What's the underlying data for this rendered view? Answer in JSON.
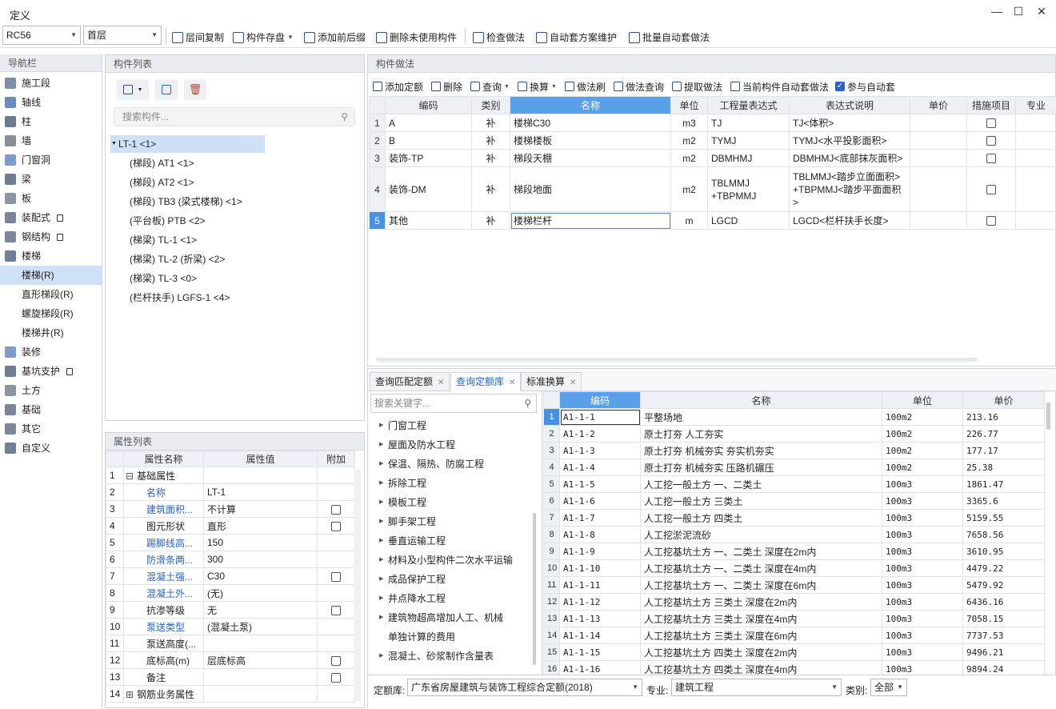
{
  "window": {
    "title": "定义",
    "min": "—",
    "max": "☐",
    "close": "✕"
  },
  "toolbar": {
    "spec_select": "RC56",
    "floor_select": "首层",
    "buttons": [
      "层间复制",
      "构件存盘",
      "添加前后缀",
      "删除未使用构件",
      "检查做法",
      "自动套方案维护",
      "批量自动套做法"
    ]
  },
  "nav": {
    "header": "导航栏",
    "items": [
      {
        "label": "施工段",
        "lock": false,
        "sub": false,
        "active": false
      },
      {
        "label": "轴线",
        "lock": false,
        "sub": false,
        "active": false
      },
      {
        "label": "柱",
        "lock": false,
        "sub": false,
        "active": false
      },
      {
        "label": "墙",
        "lock": false,
        "sub": false,
        "active": false
      },
      {
        "label": "门窗洞",
        "lock": false,
        "sub": false,
        "active": false
      },
      {
        "label": "梁",
        "lock": false,
        "sub": false,
        "active": false
      },
      {
        "label": "板",
        "lock": false,
        "sub": false,
        "active": false
      },
      {
        "label": "装配式",
        "lock": true,
        "sub": false,
        "active": false
      },
      {
        "label": "钢结构",
        "lock": true,
        "sub": false,
        "active": false
      },
      {
        "label": "楼梯",
        "lock": false,
        "sub": false,
        "active": false
      },
      {
        "label": "楼梯(R)",
        "lock": false,
        "sub": true,
        "active": true
      },
      {
        "label": "直形梯段(R)",
        "lock": false,
        "sub": true,
        "active": false
      },
      {
        "label": "螺旋梯段(R)",
        "lock": false,
        "sub": true,
        "active": false
      },
      {
        "label": "楼梯井(R)",
        "lock": false,
        "sub": true,
        "active": false
      },
      {
        "label": "装修",
        "lock": false,
        "sub": false,
        "active": false
      },
      {
        "label": "基坑支护",
        "lock": true,
        "sub": false,
        "active": false
      },
      {
        "label": "土方",
        "lock": false,
        "sub": false,
        "active": false
      },
      {
        "label": "基础",
        "lock": false,
        "sub": false,
        "active": false
      },
      {
        "label": "其它",
        "lock": false,
        "sub": false,
        "active": false
      },
      {
        "label": "自定义",
        "lock": false,
        "sub": false,
        "active": false
      }
    ]
  },
  "components": {
    "header": "构件列表",
    "search_placeholder": "搜索构件...",
    "root": "LT-1 <1>",
    "children": [
      "(梯段) AT1 <1>",
      "(梯段) AT2 <1>",
      "(梯段) TB3 (梁式楼梯)  <1>",
      "(平台板) PTB <2>",
      "(梯梁) TL-1 <1>",
      "(梯梁) TL-2 (折梁)  <2>",
      "(梯梁) TL-3 <0>",
      "(栏杆扶手) LGFS-1 <4>"
    ]
  },
  "properties": {
    "header": "属性列表",
    "columns": [
      "属性名称",
      "属性值",
      "附加"
    ],
    "rows": [
      {
        "n": "1",
        "name": "基础属性",
        "value": "",
        "cb": false,
        "blue": false,
        "group": true
      },
      {
        "n": "2",
        "name": "名称",
        "value": "LT-1",
        "cb": false,
        "blue": true,
        "group": false
      },
      {
        "n": "3",
        "name": "建筑面积...",
        "value": "不计算",
        "cb": true,
        "blue": true,
        "group": false
      },
      {
        "n": "4",
        "name": "图元形状",
        "value": "直形",
        "cb": true,
        "blue": false,
        "group": false
      },
      {
        "n": "5",
        "name": "踢脚线高...",
        "value": "150",
        "cb": false,
        "blue": true,
        "group": false
      },
      {
        "n": "6",
        "name": "防滑条两...",
        "value": "300",
        "cb": false,
        "blue": true,
        "group": false
      },
      {
        "n": "7",
        "name": "混凝土强...",
        "value": "C30",
        "cb": true,
        "blue": true,
        "group": false
      },
      {
        "n": "8",
        "name": "混凝土外...",
        "value": "(无)",
        "cb": false,
        "blue": true,
        "group": false
      },
      {
        "n": "9",
        "name": "抗渗等级",
        "value": "无",
        "cb": true,
        "blue": false,
        "group": false
      },
      {
        "n": "10",
        "name": "泵送类型",
        "value": "(混凝土泵)",
        "cb": false,
        "blue": true,
        "group": false
      },
      {
        "n": "11",
        "name": "泵送高度(...",
        "value": "",
        "cb": false,
        "blue": false,
        "group": false
      },
      {
        "n": "12",
        "name": "底标高(m)",
        "value": "层底标高",
        "cb": true,
        "blue": false,
        "group": false
      },
      {
        "n": "13",
        "name": "备注",
        "value": "",
        "cb": true,
        "blue": false,
        "group": false
      },
      {
        "n": "14",
        "name": "钢筋业务属性",
        "value": "",
        "cb": false,
        "blue": false,
        "group": true
      }
    ]
  },
  "method": {
    "header": "构件做法",
    "toolbar": [
      "添加定额",
      "删除",
      "查询",
      "换算",
      "做法刷",
      "做法查询",
      "提取做法",
      "当前构件自动套做法",
      "参与自动套"
    ],
    "columns": [
      "编码",
      "类别",
      "名称",
      "单位",
      "工程量表达式",
      "表达式说明",
      "单价",
      "措施项目",
      "专业"
    ],
    "rows": [
      {
        "n": "1",
        "code": "A",
        "type": "补",
        "name": "楼梯C30",
        "unit": "m3",
        "expr": "TJ",
        "desc": "TJ<体积>"
      },
      {
        "n": "2",
        "code": "B",
        "type": "补",
        "name": "楼梯楼板",
        "unit": "m2",
        "expr": "TYMJ",
        "desc": "TYMJ<水平投影面积>"
      },
      {
        "n": "3",
        "code": "装饰-TP",
        "type": "补",
        "name": "梯段天棚",
        "unit": "m2",
        "expr": "DBMHMJ",
        "desc": "DBMHMJ<底部抹灰面积>"
      },
      {
        "n": "4",
        "code": "装饰-DM",
        "type": "补",
        "name": "梯段地面",
        "unit": "m2",
        "expr": "TBLMMJ\n+TBPMMJ",
        "desc": "TBLMMJ<踏步立面面积>\n+TBPMMJ<踏步平面面积\n>"
      },
      {
        "n": "5",
        "code": "其他",
        "type": "补",
        "name": "楼梯栏杆",
        "unit": "m",
        "expr": "LGCD",
        "desc": "LGCD<栏杆扶手长度>"
      }
    ]
  },
  "lower": {
    "tabs": [
      "查询匹配定额",
      "查询定额库",
      "标准换算"
    ],
    "search_placeholder": "搜索关键字...",
    "categories": [
      "门窗工程",
      "屋面及防水工程",
      "保温、隔热、防腐工程",
      "拆除工程",
      "模板工程",
      "脚手架工程",
      "垂直运输工程",
      "材料及小型构件二次水平运输",
      "成品保护工程",
      "井点降水工程",
      "建筑物超高增加人工、机械",
      "单独计算的费用",
      "混凝土、砂浆制作含量表"
    ],
    "quota_columns": [
      "编码",
      "名称",
      "单位",
      "单价"
    ],
    "quota_rows": [
      {
        "n": "1",
        "code": "A1-1-1",
        "name": "平整场地",
        "unit": "100m2",
        "price": "213.16"
      },
      {
        "n": "2",
        "code": "A1-1-2",
        "name": "原土打夯 人工夯实",
        "unit": "100m2",
        "price": "226.77"
      },
      {
        "n": "3",
        "code": "A1-1-3",
        "name": "原土打夯 机械夯实 夯实机夯实",
        "unit": "100m2",
        "price": "177.17"
      },
      {
        "n": "4",
        "code": "A1-1-4",
        "name": "原土打夯 机械夯实 压路机碾压",
        "unit": "100m2",
        "price": "25.38"
      },
      {
        "n": "5",
        "code": "A1-1-5",
        "name": "人工挖一般土方 一、二类土",
        "unit": "100m3",
        "price": "1861.47"
      },
      {
        "n": "6",
        "code": "A1-1-6",
        "name": "人工挖一般土方 三类土",
        "unit": "100m3",
        "price": "3365.6"
      },
      {
        "n": "7",
        "code": "A1-1-7",
        "name": "人工挖一般土方 四类土",
        "unit": "100m3",
        "price": "5159.55"
      },
      {
        "n": "8",
        "code": "A1-1-8",
        "name": "人工挖淤泥流砂",
        "unit": "100m3",
        "price": "7658.56"
      },
      {
        "n": "9",
        "code": "A1-1-9",
        "name": "人工挖基坑土方 一、二类土 深度在2m内",
        "unit": "100m3",
        "price": "3610.95"
      },
      {
        "n": "10",
        "code": "A1-1-10",
        "name": "人工挖基坑土方 一、二类土 深度在4m内",
        "unit": "100m3",
        "price": "4479.22"
      },
      {
        "n": "11",
        "code": "A1-1-11",
        "name": "人工挖基坑土方 一、二类土 深度在6m内",
        "unit": "100m3",
        "price": "5479.92"
      },
      {
        "n": "12",
        "code": "A1-1-12",
        "name": "人工挖基坑土方 三类土 深度在2m内",
        "unit": "100m3",
        "price": "6436.16"
      },
      {
        "n": "13",
        "code": "A1-1-13",
        "name": "人工挖基坑土方 三类土 深度在4m内",
        "unit": "100m3",
        "price": "7058.15"
      },
      {
        "n": "14",
        "code": "A1-1-14",
        "name": "人工挖基坑土方 三类土 深度在6m内",
        "unit": "100m3",
        "price": "7737.53"
      },
      {
        "n": "15",
        "code": "A1-1-15",
        "name": "人工挖基坑土方 四类土 深度在2m内",
        "unit": "100m3",
        "price": "9496.21"
      },
      {
        "n": "16",
        "code": "A1-1-16",
        "name": "人工挖基坑土方 四类土 深度在4m内",
        "unit": "100m3",
        "price": "9894.24"
      }
    ],
    "footer": {
      "lib_label": "定额库:",
      "lib_value": "广东省房屋建筑与装饰工程综合定额(2018)",
      "spec_label": "专业:",
      "spec_value": "建筑工程",
      "type_label": "类别:",
      "type_value": "全部"
    }
  }
}
